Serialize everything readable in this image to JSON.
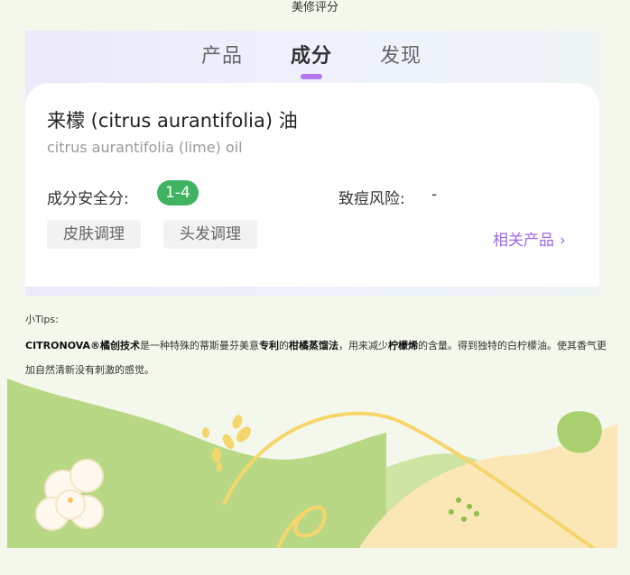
{
  "header": {
    "title": "美修评分"
  },
  "tabs": [
    {
      "label": "产品",
      "active": false
    },
    {
      "label": "成分",
      "active": true
    },
    {
      "label": "发现",
      "active": false
    }
  ],
  "ingredient": {
    "name": "来檬 (citrus aurantifolia) 油",
    "inci": "citrus aurantifolia (lime) oil",
    "safety_label": "成分安全分:",
    "safety_score": "1-4",
    "acne_label": "致痘风险:",
    "acne_value": "-",
    "tags": [
      "皮肤调理",
      "头发调理"
    ],
    "related_label": "相关产品",
    "related_chevron": "›"
  },
  "tips": {
    "label": "小Tips:",
    "b1": "CITRONOVA®橘创技术",
    "t1": "是一种特殊的蒂斯曼芬美意",
    "b2": "专利",
    "t2": "的",
    "b3": "柑橘蒸馏法",
    "t3": "，用来减少",
    "b4": "柠檬烯",
    "t4": "的含量。得到独特的白柠檬油。使其香气更加自然清新没有刺激的感觉。"
  },
  "colors": {
    "accent": "#b378f0",
    "related_link": "#a066e8",
    "safety_badge": "#3fb35f",
    "background": "#f4f8ec"
  }
}
